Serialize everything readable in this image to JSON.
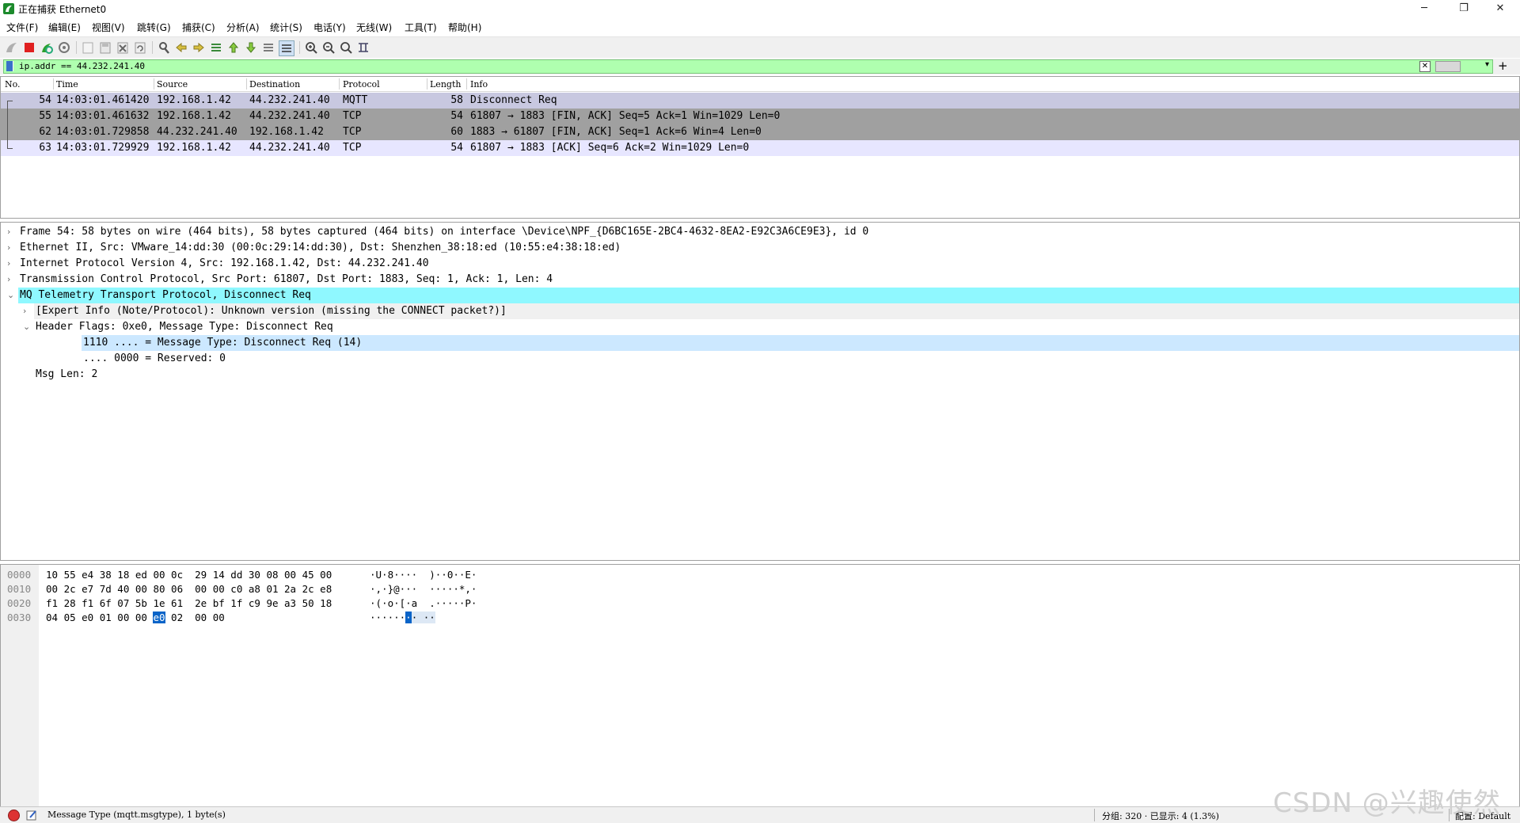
{
  "window": {
    "title": "正在捕获 Ethernet0",
    "minimize": "─",
    "restore": "❐",
    "close": "✕"
  },
  "menu": [
    "文件(F)",
    "编辑(E)",
    "视图(V)",
    "跳转(G)",
    "捕获(C)",
    "分析(A)",
    "统计(S)",
    "电话(Y)",
    "无线(W)",
    "工具(T)",
    "帮助(H)"
  ],
  "toolbar_icons": [
    "shark-fin-start-icon",
    "stop-icon",
    "restart-icon",
    "capture-options-icon",
    "open-file-icon",
    "save-file-icon",
    "close-file-icon",
    "reload-icon",
    "find-icon",
    "go-back-icon",
    "go-forward-icon",
    "go-to-packet-icon",
    "go-first-icon",
    "go-last-icon",
    "auto-scroll-icon",
    "colorize-icon",
    "zoom-in-icon",
    "zoom-out-icon",
    "zoom-normal-icon",
    "resize-columns-icon"
  ],
  "filter": {
    "value": "ip.addr == 44.232.241.40",
    "clear_glyph": "✕",
    "dropdown_glyph": "▾",
    "add_glyph": "+"
  },
  "packet_list": {
    "columns": [
      "No.",
      "Time",
      "Source",
      "Destination",
      "Protocol",
      "Length",
      "Info"
    ],
    "rows": [
      {
        "no": "54",
        "time": "14:03:01.461420",
        "src": "192.168.1.42",
        "dst": "44.232.241.40",
        "proto": "MQTT",
        "len": "58",
        "info": "Disconnect Req",
        "bg": "#c8c8e0"
      },
      {
        "no": "55",
        "time": "14:03:01.461632",
        "src": "192.168.1.42",
        "dst": "44.232.241.40",
        "proto": "TCP",
        "len": "54",
        "info": "61807 → 1883 [FIN, ACK] Seq=5 Ack=1 Win=1029 Len=0",
        "bg": "#a0a0a0"
      },
      {
        "no": "62",
        "time": "14:03:01.729858",
        "src": "44.232.241.40",
        "dst": "192.168.1.42",
        "proto": "TCP",
        "len": "60",
        "info": "1883 → 61807 [FIN, ACK] Seq=1 Ack=6 Win=4 Len=0",
        "bg": "#a0a0a0"
      },
      {
        "no": "63",
        "time": "14:03:01.729929",
        "src": "192.168.1.42",
        "dst": "44.232.241.40",
        "proto": "TCP",
        "len": "54",
        "info": "61807 → 1883 [ACK] Seq=6 Ack=2 Win=1029 Len=0",
        "bg": "#e7e6ff"
      }
    ]
  },
  "details": [
    {
      "arrow": "›",
      "text": "Frame 54: 58 bytes on wire (464 bits), 58 bytes captured (464 bits) on interface \\Device\\NPF_{D6BC165E-2BC4-4632-8EA2-E92C3A6CE9E3}, id 0",
      "bg": "#ffffff"
    },
    {
      "arrow": "›",
      "text": "Ethernet II, Src: VMware_14:dd:30 (00:0c:29:14:dd:30), Dst: Shenzhen_38:18:ed (10:55:e4:38:18:ed)",
      "bg": "#ffffff"
    },
    {
      "arrow": "›",
      "text": "Internet Protocol Version 4, Src: 192.168.1.42, Dst: 44.232.241.40",
      "bg": "#ffffff"
    },
    {
      "arrow": "›",
      "text": "Transmission Control Protocol, Src Port: 61807, Dst Port: 1883, Seq: 1, Ack: 1, Len: 4",
      "bg": "#ffffff"
    },
    {
      "arrow": "⌄",
      "text": "MQ Telemetry Transport Protocol, Disconnect Req",
      "bg": "#8ff8ff"
    },
    {
      "arrow": "›",
      "text": "[Expert Info (Note/Protocol): Unknown version (missing the CONNECT packet?)]",
      "bg": "#f0f0f0"
    },
    {
      "arrow": "⌄",
      "text": "Header Flags: 0xe0, Message Type: Disconnect Req",
      "bg": "#ffffff"
    },
    {
      "arrow": "",
      "text": "1110 .... = Message Type: Disconnect Req (14)",
      "bg": "#cce8ff"
    },
    {
      "arrow": "",
      "text": ".... 0000 = Reserved: 0",
      "bg": "#ffffff"
    },
    {
      "arrow": "",
      "text": "Msg Len: 2",
      "bg": "#ffffff"
    }
  ],
  "bytes": [
    {
      "off": "0000",
      "hex": "10 55 e4 38 18 ed 00 0c  29 14 dd 30 08 00 45 00",
      "ascii": "·U·8····  )··0··E·"
    },
    {
      "off": "0010",
      "hex": "00 2c e7 7d 40 00 80 06  00 00 c0 a8 01 2a 2c e8",
      "ascii": "·,·}@···  ·····*,·"
    },
    {
      "off": "0020",
      "hex": "f1 28 f1 6f 07 5b 1e 61  2e bf 1f c9 9e a3 50 18",
      "ascii": "·(·o·[·a  .·····P·"
    },
    {
      "off": "0030",
      "hex_pre": "04 05 e0 01 00 00 ",
      "hex_sel": "e0",
      "hex_post": " 02  00 00",
      "ascii_pre": "······",
      "ascii_sel": "·",
      "ascii_post": "· ··"
    }
  ],
  "status": {
    "field": "Message Type (mqtt.msgtype), 1 byte(s)",
    "packets": "分组: 320 · 已显示: 4 (1.3%)",
    "profile": "配置: Default"
  },
  "watermark": "CSDN @兴趣使然",
  "colors": {
    "filter_valid_bg": "#afffaf",
    "selected_proto_bg": "#8ff8ff",
    "selected_field_bg": "#cce8ff",
    "byte_highlight": "#0a64c8"
  }
}
